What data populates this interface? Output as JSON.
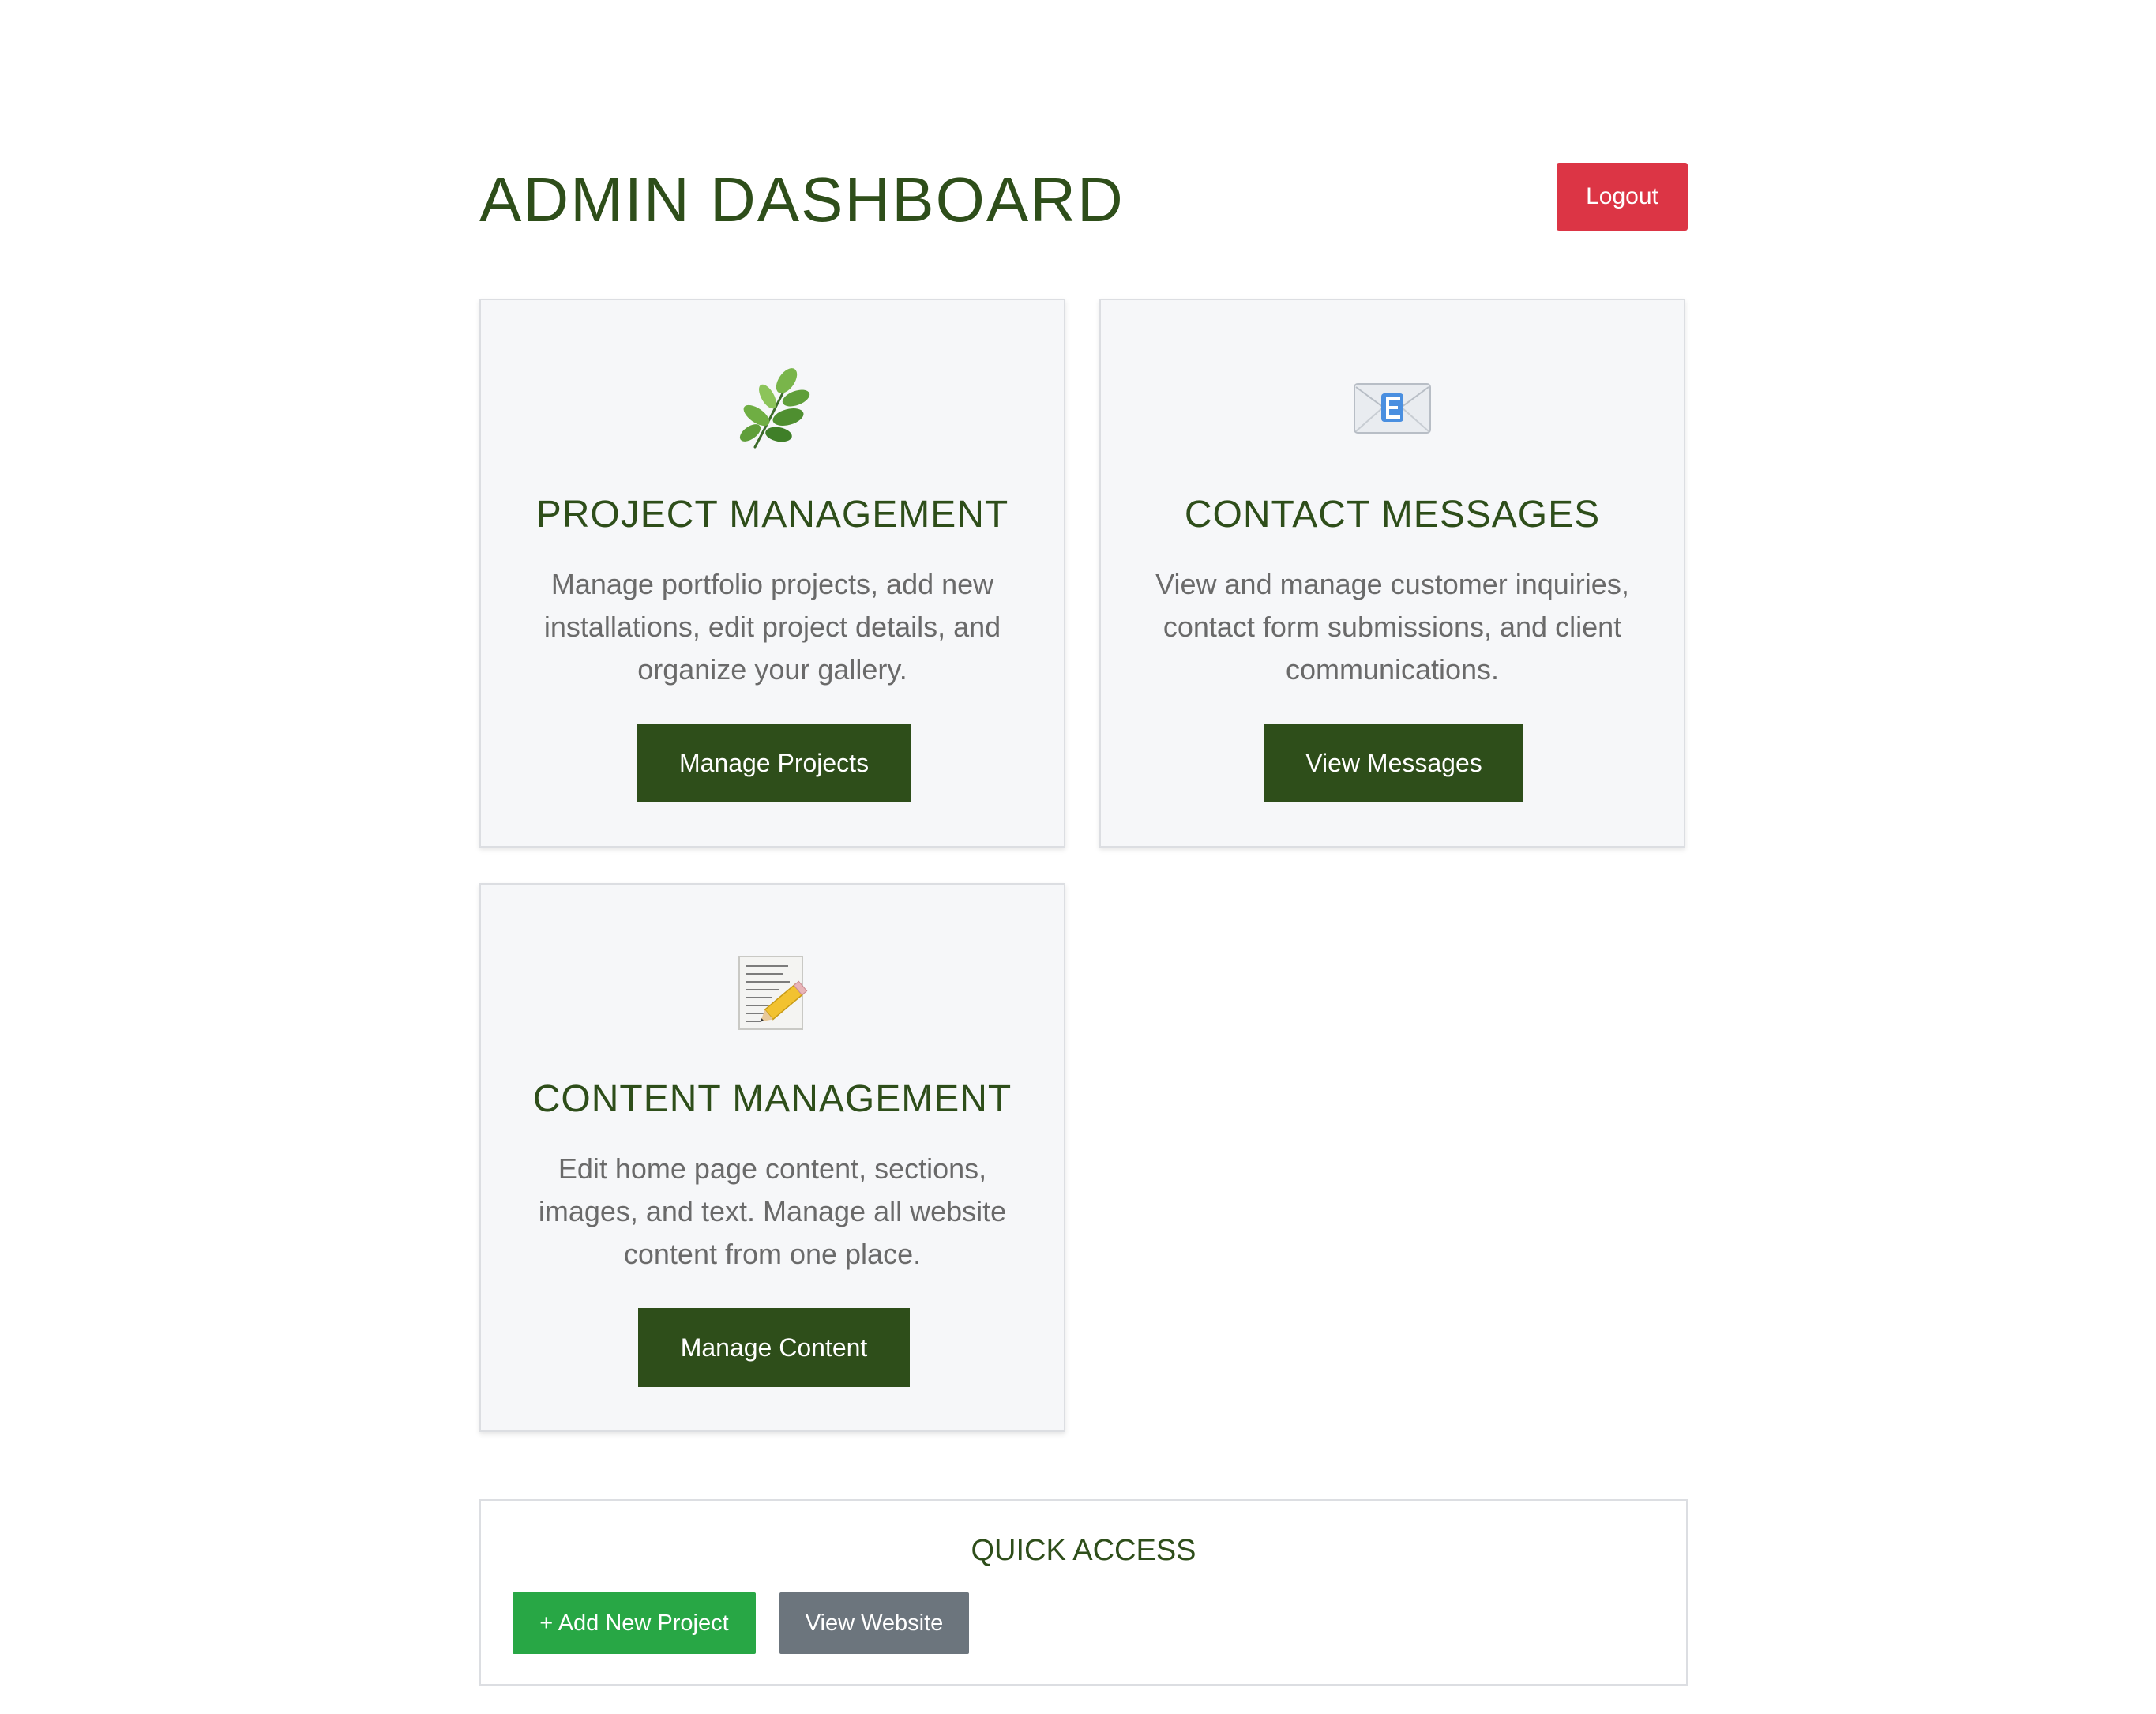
{
  "header": {
    "title": "ADMIN DASHBOARD",
    "logout_label": "Logout"
  },
  "cards": [
    {
      "icon": "leaf-icon",
      "icon_glyph": "🌿",
      "title": "PROJECT MANAGEMENT",
      "description": "Manage portfolio projects, add new installations, edit project details, and organize your gallery.",
      "button_label": "Manage Projects"
    },
    {
      "icon": "envelope-icon",
      "icon_glyph": "📧",
      "title": "CONTACT MESSAGES",
      "description": "View and manage customer inquiries, contact form submissions, and client communications.",
      "button_label": "View Messages"
    },
    {
      "icon": "memo-pencil-icon",
      "icon_glyph": "📝",
      "title": "CONTENT MANAGEMENT",
      "description": "Edit home page content, sections, images, and text. Manage all website content from one place.",
      "button_label": "Manage Content"
    }
  ],
  "quick_access": {
    "title": "QUICK ACCESS",
    "add_project_label": "+ Add New Project",
    "view_website_label": "View Website"
  },
  "colors": {
    "brand_green": "#2e4e1a",
    "danger": "#dc3545",
    "success": "#28a745",
    "secondary": "#6c757d",
    "card_bg": "#f6f7f9"
  }
}
